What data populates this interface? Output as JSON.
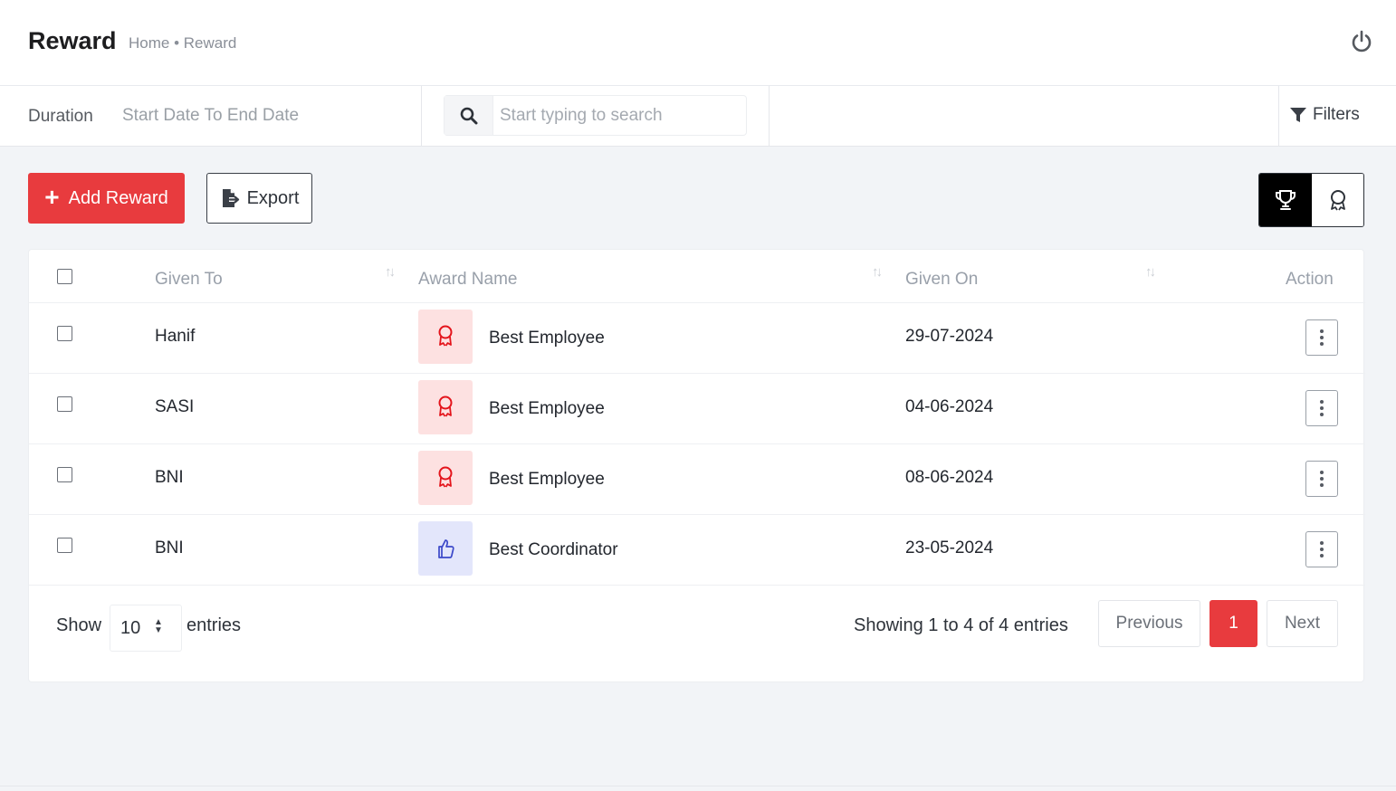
{
  "header": {
    "title": "Reward",
    "breadcrumb": "Home • Reward"
  },
  "filterbar": {
    "duration_label": "Duration",
    "duration_value": "Start Date To End Date",
    "search_placeholder": "Start typing to search",
    "filters_label": "Filters"
  },
  "toolbar": {
    "add_label": "Add Reward",
    "export_label": "Export"
  },
  "table": {
    "columns": [
      "Given To",
      "Award Name",
      "Given On",
      "Action"
    ],
    "rows": [
      {
        "given_to": "Hanif",
        "award": "Best Employee",
        "icon": "award-ribbon-icon",
        "given_on": "29-07-2024"
      },
      {
        "given_to": "SASI",
        "award": "Best Employee",
        "icon": "award-ribbon-icon",
        "given_on": "04-06-2024"
      },
      {
        "given_to": "BNI",
        "award": "Best Employee",
        "icon": "award-ribbon-icon",
        "given_on": "08-06-2024"
      },
      {
        "given_to": "BNI",
        "award": "Best Coordinator",
        "icon": "thumbs-up-icon",
        "given_on": "23-05-2024"
      }
    ]
  },
  "footer": {
    "show_label": "Show",
    "page_size": "10",
    "entries_label": "entries",
    "showing_text": "Showing 1 to 4 of 4 entries",
    "prev_label": "Previous",
    "current_page": "1",
    "next_label": "Next"
  },
  "colors": {
    "accent": "#e83b3e",
    "award_red_bg": "#fde1e1",
    "award_blue_bg": "#e3e6fb"
  }
}
